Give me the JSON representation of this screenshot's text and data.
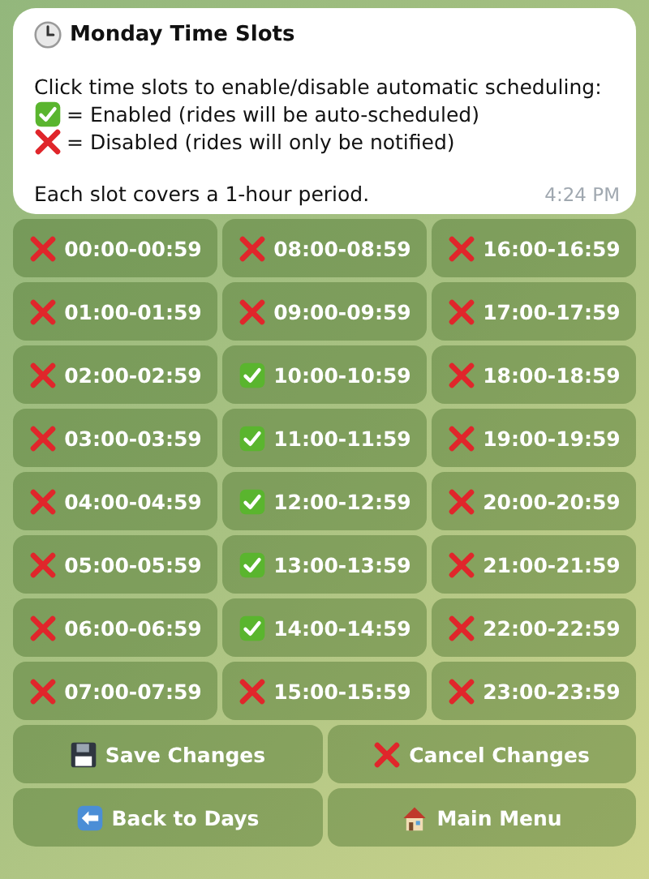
{
  "message": {
    "title": "Monday Time Slots",
    "intro": "Click time slots to enable/disable automatic scheduling:",
    "legend": [
      {
        "kind": "enabled",
        "text": "= Enabled (rides will be auto-scheduled)"
      },
      {
        "kind": "disabled",
        "text": "= Disabled (rides will only be notified)"
      }
    ],
    "note": "Each slot covers a 1-hour period.",
    "time": "4:24 PM"
  },
  "slots": [
    {
      "label": "00:00-00:59",
      "enabled": false
    },
    {
      "label": "08:00-08:59",
      "enabled": false
    },
    {
      "label": "16:00-16:59",
      "enabled": false
    },
    {
      "label": "01:00-01:59",
      "enabled": false
    },
    {
      "label": "09:00-09:59",
      "enabled": false
    },
    {
      "label": "17:00-17:59",
      "enabled": false
    },
    {
      "label": "02:00-02:59",
      "enabled": false
    },
    {
      "label": "10:00-10:59",
      "enabled": true
    },
    {
      "label": "18:00-18:59",
      "enabled": false
    },
    {
      "label": "03:00-03:59",
      "enabled": false
    },
    {
      "label": "11:00-11:59",
      "enabled": true
    },
    {
      "label": "19:00-19:59",
      "enabled": false
    },
    {
      "label": "04:00-04:59",
      "enabled": false
    },
    {
      "label": "12:00-12:59",
      "enabled": true
    },
    {
      "label": "20:00-20:59",
      "enabled": false
    },
    {
      "label": "05:00-05:59",
      "enabled": false
    },
    {
      "label": "13:00-13:59",
      "enabled": true
    },
    {
      "label": "21:00-21:59",
      "enabled": false
    },
    {
      "label": "06:00-06:59",
      "enabled": false
    },
    {
      "label": "14:00-14:59",
      "enabled": true
    },
    {
      "label": "22:00-22:59",
      "enabled": false
    },
    {
      "label": "07:00-07:59",
      "enabled": false
    },
    {
      "label": "15:00-15:59",
      "enabled": false
    },
    {
      "label": "23:00-23:59",
      "enabled": false
    }
  ],
  "actions": [
    {
      "kind": "save",
      "label": "Save Changes"
    },
    {
      "kind": "cancel",
      "label": "Cancel Changes"
    },
    {
      "kind": "back",
      "label": "Back to Days"
    },
    {
      "kind": "home",
      "label": "Main Menu"
    }
  ]
}
